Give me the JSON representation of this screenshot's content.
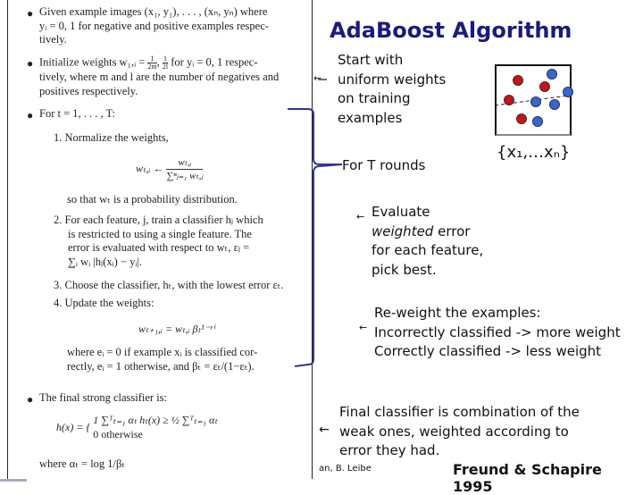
{
  "slide": {
    "title": "AdaBoost Algorithm",
    "credit": "an, B. Leibe",
    "citation": "Freund & Schapire 1995",
    "colors": {
      "title": "#1a1a80",
      "bracket": "#33339a",
      "positive_point": "#cc1111",
      "negative_point": "#3366dd"
    }
  },
  "paper": {
    "bullet1": [
      "Given example images (x₁, y₁), . . . , (xₙ, yₙ) where",
      "yᵢ = 0, 1  for negative and positive examples respec-",
      "tively."
    ],
    "bullet2_a": "Initialize weights w₁,ᵢ =",
    "bullet2_frac1_num": "1",
    "bullet2_frac1_den": "2m",
    "bullet2_frac2_num": "1",
    "bullet2_frac2_den": "2l",
    "bullet2_b": "for yᵢ = 0, 1 respec-",
    "bullet2_lines": [
      "tively, where m and l are the number of negatives and",
      "positives respectively."
    ],
    "bullet3": "For t = 1, . . . , T:",
    "step1": "1. Normalize the weights,",
    "step1_eq_lhs": "wₜ,ᵢ ←",
    "step1_eq_num": "wₜ,ᵢ",
    "step1_eq_den": "∑ⁿⱼ₌₁ wₜ,ⱼ",
    "step1_note": "so that wₜ is a probability distribution.",
    "step2": [
      "2. For each feature, j, train a classifier hⱼ which",
      "is restricted to using a single feature.  The",
      "error is evaluated with respect to wₜ, εⱼ =",
      "∑ᵢ wᵢ |hⱼ(xᵢ) − yᵢ|."
    ],
    "step3": "3. Choose the classifier, hₜ, with the lowest error εₜ.",
    "step4": "4. Update the weights:",
    "step4_eq": "wₜ₊₁,ᵢ = wₜ,ᵢ βₜ¹⁻ᵉⁱ",
    "step4_note": [
      "where eᵢ = 0 if example xᵢ is classified cor-",
      "rectly, eᵢ = 1 otherwise, and βₜ = εₜ/(1−εₜ)."
    ],
    "bullet4": "The final strong classifier is:",
    "final_lhs": "h(x) = {",
    "final_case1": "1    ∑ᵀₜ₌₁ αₜ hₜ(x) ≥ ½ ∑ᵀₜ₌₁ αₜ",
    "final_case2": "0    otherwise",
    "alpha_def": "where αₜ = log 1/βₜ"
  },
  "annotations": {
    "start": [
      "Start with",
      "uniform weights",
      "on training",
      "examples"
    ],
    "rounds": "For T rounds",
    "evaluate_1": "Evaluate",
    "evaluate_2_em": "weighted",
    "evaluate_2_rest": " error",
    "evaluate_3": "for each feature,",
    "evaluate_4": "pick best.",
    "reweight": [
      "Re-weight the examples:",
      "Incorrectly classified -> more weight",
      "Correctly classified -> less weight"
    ],
    "final": [
      "Final classifier is combination of the",
      "weak ones, weighted according to",
      "error they had."
    ],
    "set_label": "{x₁,…xₙ}",
    "arrow_glyph": "←"
  },
  "diagram": {
    "points": [
      {
        "class": "positive"
      },
      {
        "class": "positive"
      },
      {
        "class": "positive"
      },
      {
        "class": "positive"
      },
      {
        "class": "negative"
      },
      {
        "class": "negative"
      },
      {
        "class": "negative"
      },
      {
        "class": "negative"
      },
      {
        "class": "negative"
      }
    ]
  }
}
